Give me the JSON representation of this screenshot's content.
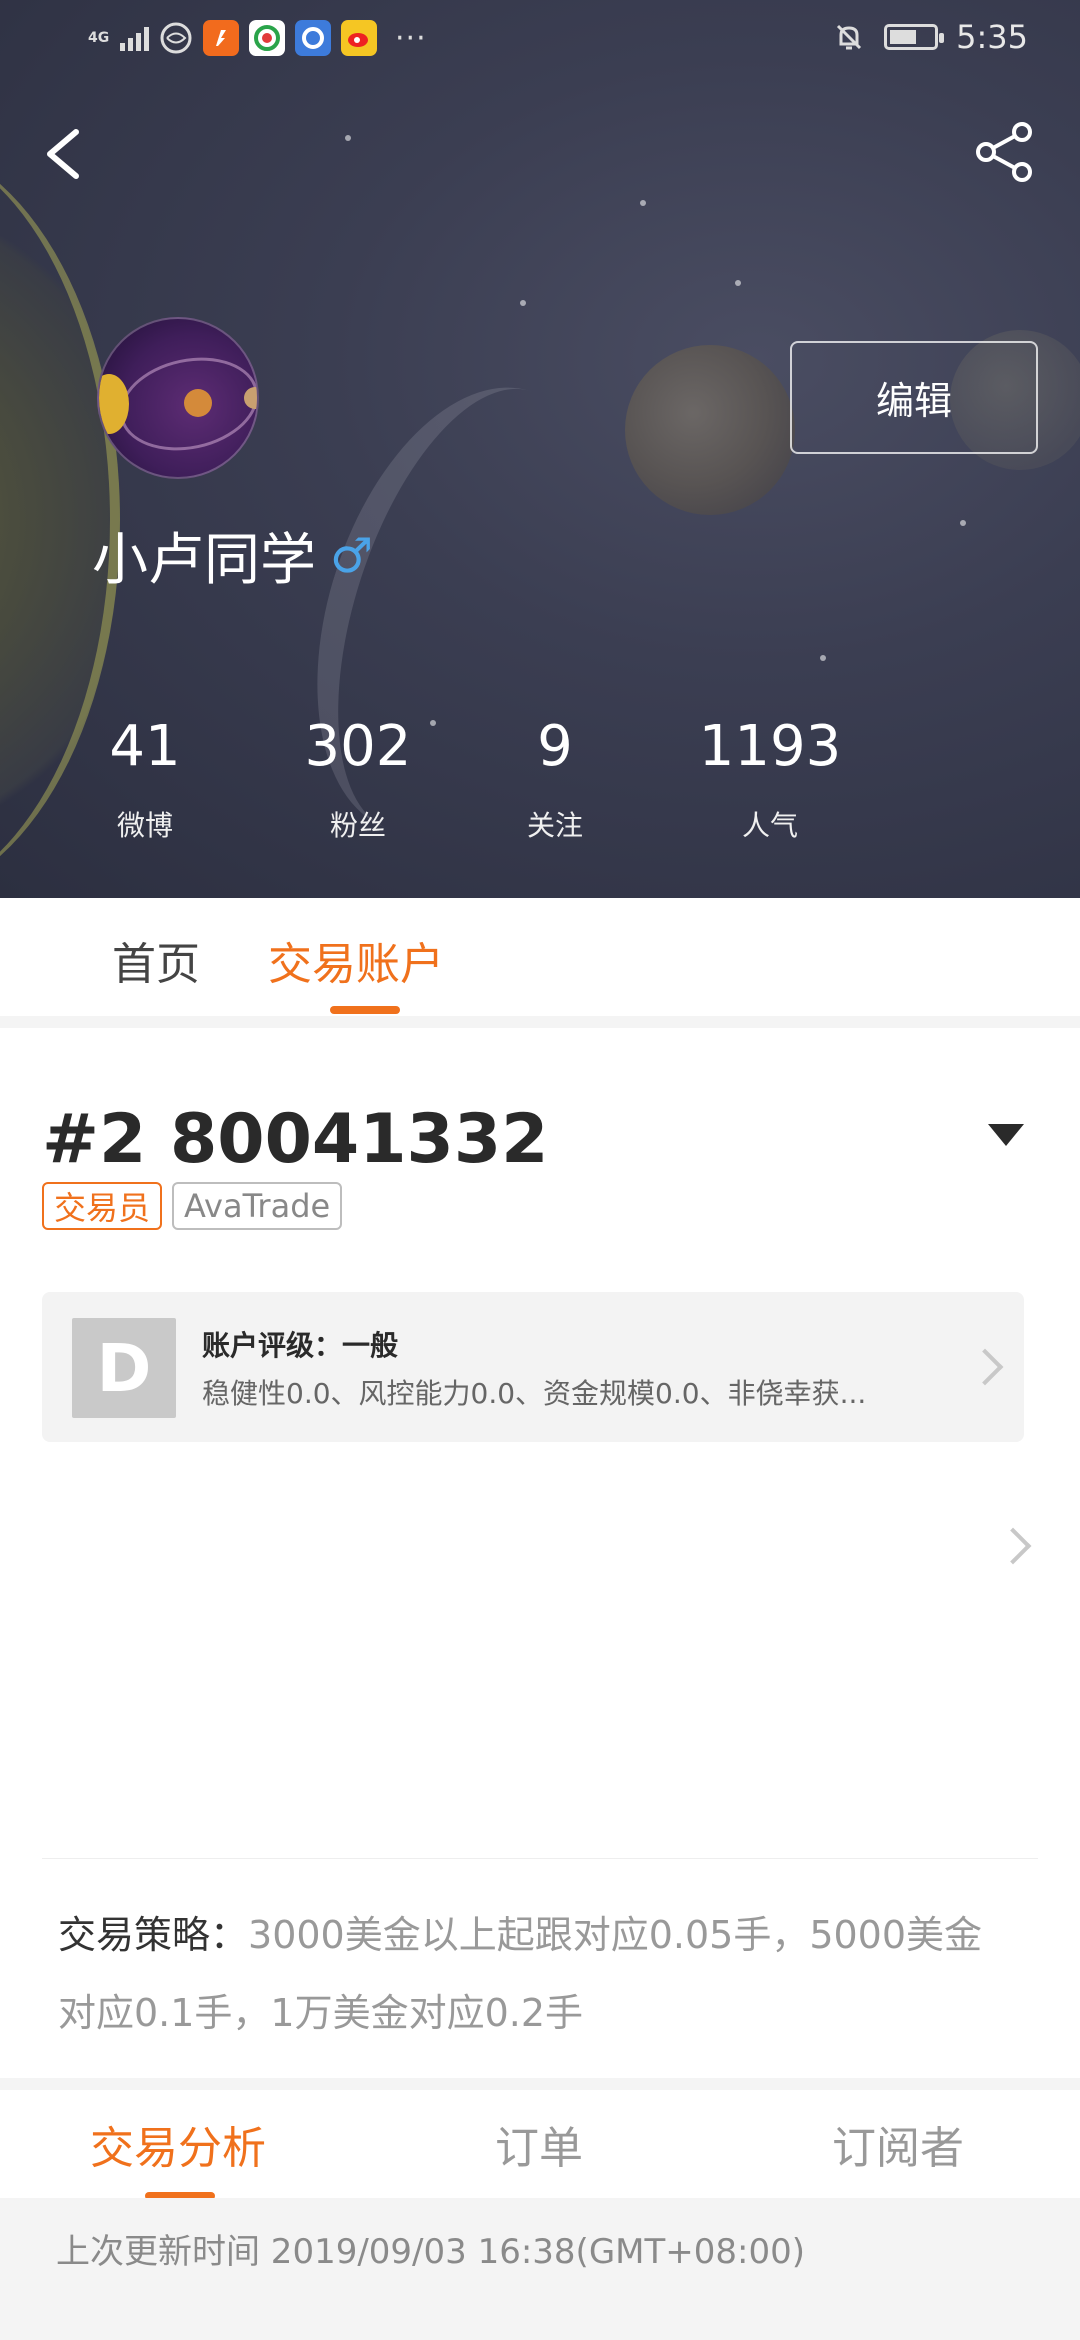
{
  "status_bar": {
    "network": "4G",
    "time": "5:35",
    "more": "···"
  },
  "profile": {
    "username": "小卢同学",
    "gender_symbol": "♂",
    "edit_label": "编辑",
    "stats": [
      {
        "value": "41",
        "label": "微博"
      },
      {
        "value": "302",
        "label": "粉丝"
      },
      {
        "value": "9",
        "label": "关注"
      },
      {
        "value": "1193",
        "label": "人气"
      }
    ]
  },
  "tabs": {
    "home": "首页",
    "account": "交易账户"
  },
  "account": {
    "title": "#2 80041332",
    "role_tag": "交易员",
    "broker_tag": "AvaTrade",
    "rating": {
      "grade": "D",
      "title": "账户评级：一般",
      "description": "稳健性0.0、风控能力0.0、资金规模0.0、非侥幸获..."
    },
    "strategy_label": "交易策略：",
    "strategy_text": "3000美金以上起跟对应0.05手，5000美金对应0.1手，1万美金对应0.2手"
  },
  "subtabs": {
    "analysis": "交易分析",
    "orders": "订单",
    "subscribers": "订阅者"
  },
  "update_text": "上次更新时间 2019/09/03 16:38(GMT+08:00)",
  "colors": {
    "accent": "#f0711c",
    "gender": "#4aa3e8"
  }
}
